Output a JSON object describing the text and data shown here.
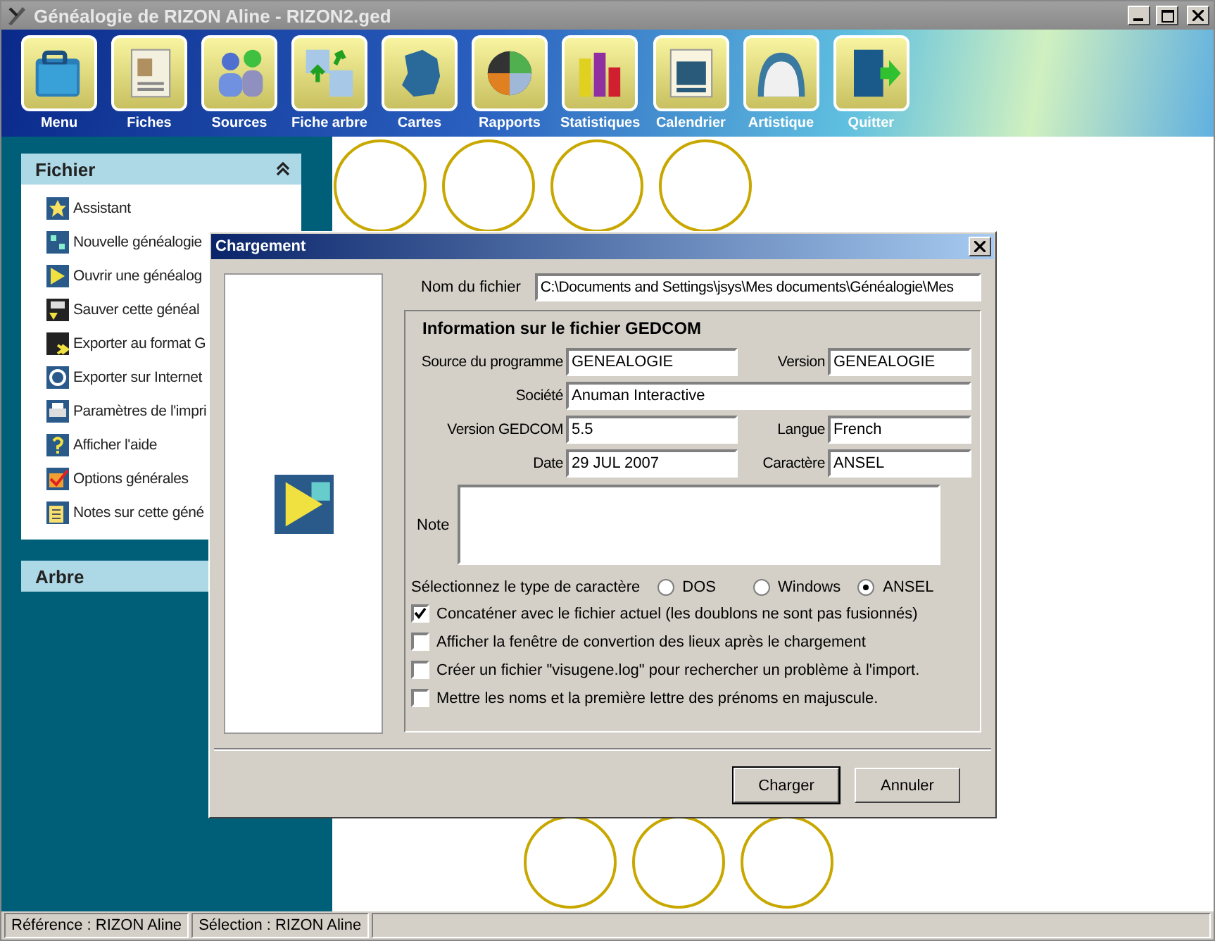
{
  "window": {
    "title": "Généalogie de RIZON Aline - RIZON2.ged"
  },
  "toolbar": [
    {
      "label": "Menu"
    },
    {
      "label": "Fiches"
    },
    {
      "label": "Sources"
    },
    {
      "label": "Fiche arbre"
    },
    {
      "label": "Cartes"
    },
    {
      "label": "Rapports"
    },
    {
      "label": "Statistiques"
    },
    {
      "label": "Calendrier"
    },
    {
      "label": "Artistique"
    },
    {
      "label": "Quitter"
    }
  ],
  "sidebar": {
    "panels": [
      {
        "title": "Fichier",
        "expanded": true,
        "items": [
          "Assistant",
          "Nouvelle généalogie",
          "Ouvrir une généalog",
          "Sauver cette généal",
          "Exporter au format G",
          "Exporter sur Internet",
          "Paramètres de l'impri",
          "Afficher l'aide",
          "Options générales",
          "Notes sur cette géné"
        ]
      },
      {
        "title": "Arbre",
        "expanded": false
      }
    ]
  },
  "dialog": {
    "title": "Chargement",
    "file_label": "Nom du fichier",
    "file_value": "C:\\Documents and Settings\\jsys\\Mes documents\\Généalogie\\Mes",
    "group_title": "Information sur le fichier GEDCOM",
    "field_rows": [
      [
        {
          "label": "Source du programme",
          "value": "GENEALOGIE"
        },
        {
          "label": "Version",
          "value": "GENEALOGIE"
        }
      ],
      [
        {
          "label": "Société",
          "value": "Anuman Interactive"
        }
      ],
      [
        {
          "label": "Version GEDCOM",
          "value": "5.5"
        },
        {
          "label": "Langue",
          "value": "French"
        }
      ],
      [
        {
          "label": "Date",
          "value": "29 JUL 2007"
        },
        {
          "label": "Caractère",
          "value": "ANSEL"
        }
      ]
    ],
    "note_label": "Note",
    "charset_label": "Sélectionnez le type de caractère",
    "charsets": [
      {
        "label": "DOS",
        "selected": false
      },
      {
        "label": "Windows",
        "selected": false
      },
      {
        "label": "ANSEL",
        "selected": true
      }
    ],
    "options": [
      {
        "label": "Concaténer avec le fichier actuel (les doublons ne sont pas fusionnés)",
        "checked": true
      },
      {
        "label": "Afficher la fenêtre de convertion des lieux après le chargement",
        "checked": false
      },
      {
        "label": "Créer un fichier \"visugene.log\" pour rechercher un problème à l'import.",
        "checked": false
      },
      {
        "label": "Mettre les noms et la première lettre des prénoms en majuscule.",
        "checked": false
      }
    ],
    "buttons": [
      "Charger",
      "Annuler"
    ]
  },
  "status_bar": [
    "Référence : RIZON Aline",
    "Sélection : RIZON Aline"
  ]
}
